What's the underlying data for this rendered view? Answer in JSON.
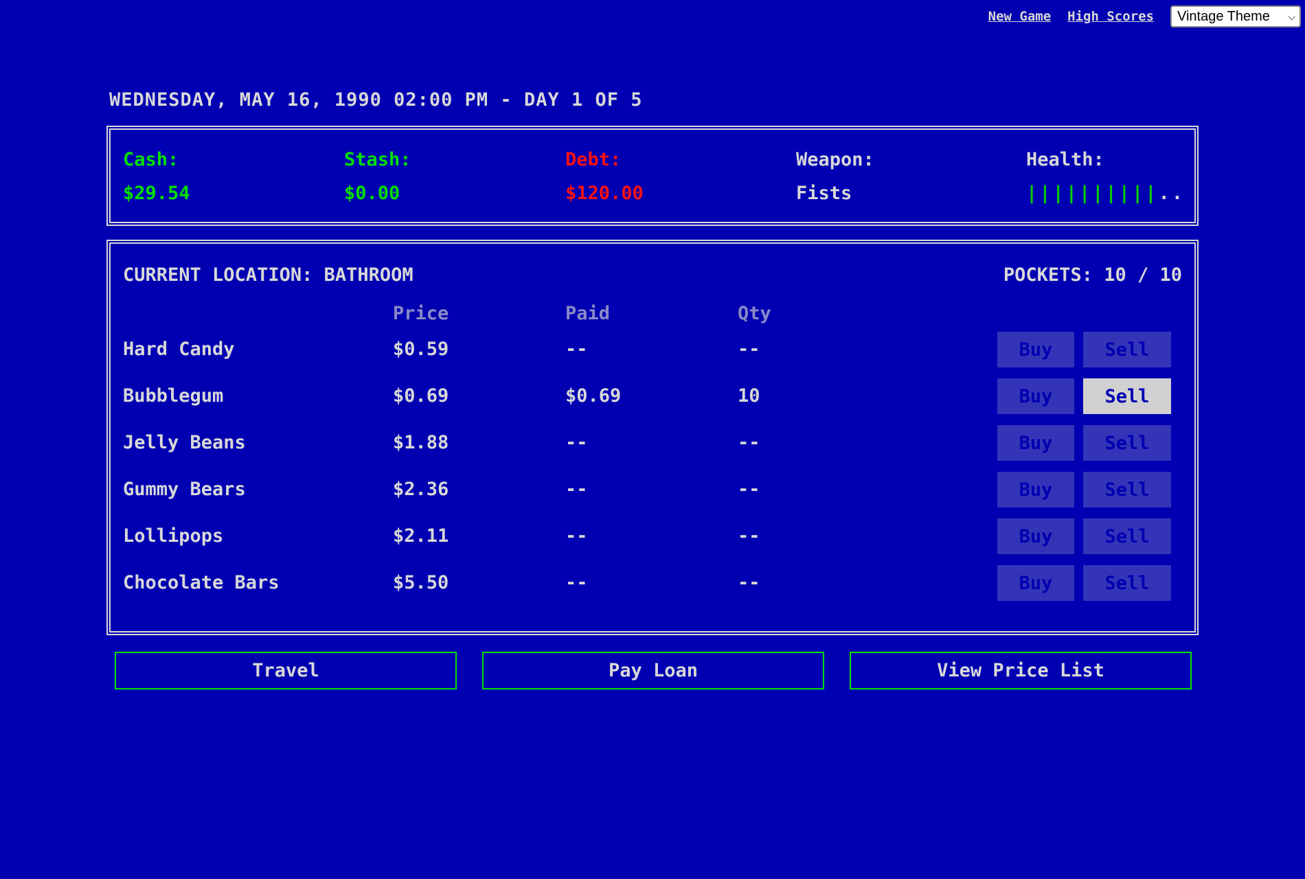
{
  "nav": {
    "new_game": "New Game",
    "high_scores": "High Scores",
    "theme_selected": "Vintage Theme"
  },
  "date_line": "WEDNESDAY, MAY 16, 1990 02:00 PM - DAY 1 OF 5",
  "stats": {
    "cash_label": "Cash:",
    "cash_value": "$29.54",
    "stash_label": "Stash:",
    "stash_value": "$0.00",
    "debt_label": "Debt:",
    "debt_value": "$120.00",
    "weapon_label": "Weapon:",
    "weapon_value": "Fists",
    "health_label": "Health:",
    "health_filled": "||||||||||",
    "health_empty": "..",
    "health_level": "10 of 12"
  },
  "market": {
    "location": "CURRENT LOCATION: BATHROOM",
    "pockets": "POCKETS: 10 / 10",
    "headers": {
      "price": "Price",
      "paid": "Paid",
      "qty": "Qty"
    },
    "buy_label": "Buy",
    "sell_label": "Sell",
    "items": [
      {
        "name": "Hard Candy",
        "price": "$0.59",
        "paid": "--",
        "qty": "--",
        "sell_enabled": false
      },
      {
        "name": "Bubblegum",
        "price": "$0.69",
        "paid": "$0.69",
        "qty": "10",
        "sell_enabled": true
      },
      {
        "name": "Jelly Beans",
        "price": "$1.88",
        "paid": "--",
        "qty": "--",
        "sell_enabled": false
      },
      {
        "name": "Gummy Bears",
        "price": "$2.36",
        "paid": "--",
        "qty": "--",
        "sell_enabled": false
      },
      {
        "name": "Lollipops",
        "price": "$2.11",
        "paid": "--",
        "qty": "--",
        "sell_enabled": false
      },
      {
        "name": "Chocolate Bars",
        "price": "$5.50",
        "paid": "--",
        "qty": "--",
        "sell_enabled": false
      }
    ]
  },
  "actions": {
    "travel": "Travel",
    "pay_loan": "Pay Loan",
    "view_price_list": "View Price List"
  },
  "colors": {
    "background": "#0000b2",
    "cash": "#00e000",
    "debt": "#ff1111",
    "action_border": "#00e000"
  }
}
